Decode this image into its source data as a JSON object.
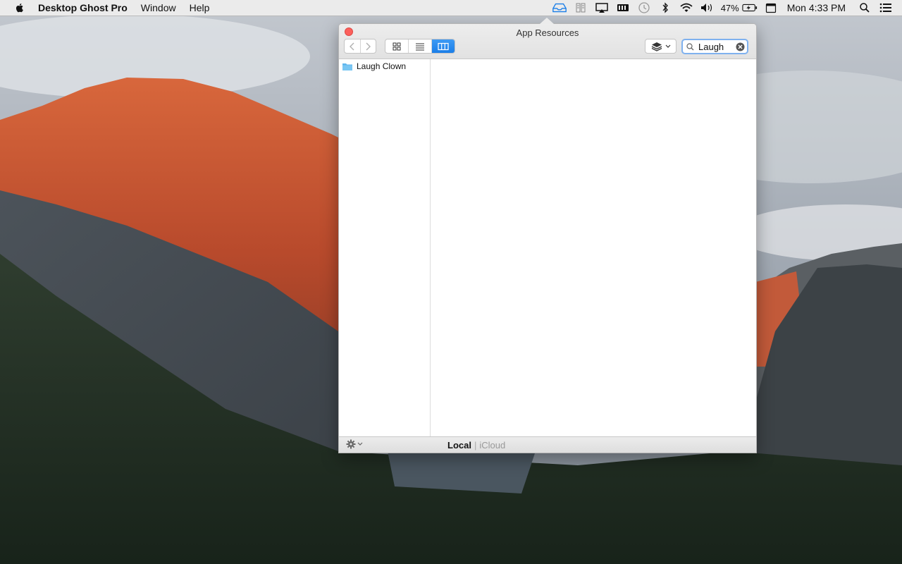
{
  "menubar": {
    "app_name": "Desktop Ghost Pro",
    "menus": [
      "Window",
      "Help"
    ],
    "battery_percent": "47%",
    "clock": "Mon 4:33 PM"
  },
  "window": {
    "title": "App Resources",
    "search": {
      "value": "Laugh"
    },
    "active_view": "column",
    "items": [
      {
        "name": "Laugh Clown",
        "type": "folder"
      }
    ]
  },
  "footer": {
    "storage_selected": "Local",
    "storage_other": "iCloud"
  },
  "colors": {
    "accent": "#1a7ee8",
    "close": "#fc605c",
    "folder": "#5fb6ee",
    "focus_ring": "#7fb1ef"
  }
}
